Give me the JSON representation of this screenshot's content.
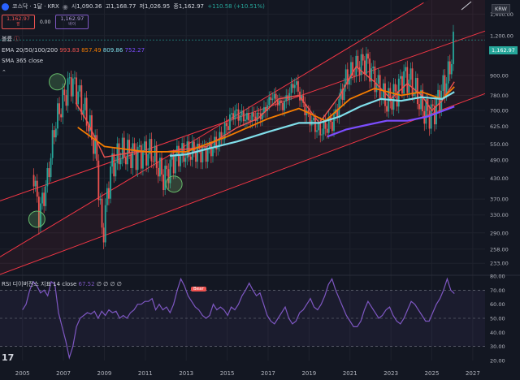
{
  "header": {
    "symbol": "코스닥 · 1달 · KRX",
    "ohlc": {
      "o": "시1,090.36",
      "h": "고1,168.77",
      "l": "저1,026.95",
      "c": "종1,162.97",
      "chg": "+110.58 (+10.51%)"
    },
    "sell_price": "1,162.97",
    "sell_label": "팔",
    "spread": "0.00",
    "buy_price": "1,162.97",
    "buy_label": "바이",
    "volume_label": "볼륨",
    "ema_label": "EMA 20/50/100/200",
    "ema_vals": [
      "993.83",
      "857.49",
      "809.86",
      "752.27"
    ],
    "sma_label": "SMA 365 close",
    "rsi_label": "RSI 디이버전스 지표 14 close",
    "rsi_val": "67.52",
    "rsi_nulls": "∅ ∅ ∅ ∅",
    "currency": "KRW",
    "last_price": "1,162.97",
    "bear_label": "Bear",
    "logo": "17"
  },
  "colors": {
    "bg": "#131722",
    "up": "#26a69a",
    "down": "#ef5350",
    "ema20": "#ef5350",
    "ema50": "#f57c00",
    "ema100": "#80deea",
    "ema200": "#7c4dff",
    "channel": "#f23645",
    "rsi": "#7e57c2",
    "circle": "#66bb6a"
  },
  "chart_data": [
    {
      "type": "candlestick",
      "x_ticks": [
        "2005",
        "2007",
        "2009",
        "2011",
        "2013",
        "2015",
        "2017",
        "2019",
        "2021",
        "2023",
        "2025",
        "2027"
      ],
      "y_scale": "log",
      "y_ticks": [
        233,
        258,
        290,
        330,
        370,
        430,
        490,
        550,
        625,
        700,
        780,
        900,
        1200,
        1400
      ],
      "ylim": [
        215,
        1550
      ],
      "xlim": [
        2003.9,
        2027.6
      ],
      "last_close": 1162.97,
      "series": [
        {
          "name": "EMA 20",
          "points": [
            [
              2007.6,
              740
            ],
            [
              2008.2,
              640
            ],
            [
              2009.0,
              500
            ],
            [
              2010.5,
              520
            ],
            [
              2012.0,
              520
            ],
            [
              2014.0,
              540
            ],
            [
              2015.5,
              620
            ],
            [
              2016.5,
              660
            ],
            [
              2017.5,
              760
            ],
            [
              2018.5,
              780
            ],
            [
              2019.5,
              640
            ],
            [
              2020.5,
              780
            ],
            [
              2021.3,
              960
            ],
            [
              2022.2,
              860
            ],
            [
              2023.0,
              760
            ],
            [
              2023.8,
              850
            ],
            [
              2024.5,
              780
            ],
            [
              2025.0,
              700
            ],
            [
              2025.5,
              750
            ],
            [
              2026.1,
              860
            ]
          ]
        },
        {
          "name": "EMA 50",
          "points": [
            [
              2007.7,
              620
            ],
            [
              2009.0,
              540
            ],
            [
              2011.0,
              520
            ],
            [
              2013.0,
              520
            ],
            [
              2015.0,
              580
            ],
            [
              2017.0,
              660
            ],
            [
              2018.5,
              710
            ],
            [
              2019.8,
              650
            ],
            [
              2021.0,
              760
            ],
            [
              2022.2,
              820
            ],
            [
              2023.5,
              780
            ],
            [
              2024.5,
              800
            ],
            [
              2025.5,
              760
            ],
            [
              2026.1,
              830
            ]
          ]
        },
        {
          "name": "EMA 100",
          "points": [
            [
              2012.2,
              505
            ],
            [
              2013.0,
              510
            ],
            [
              2014.0,
              530
            ],
            [
              2015.5,
              560
            ],
            [
              2017.0,
              600
            ],
            [
              2018.5,
              640
            ],
            [
              2019.5,
              640
            ],
            [
              2020.5,
              670
            ],
            [
              2021.5,
              720
            ],
            [
              2022.5,
              760
            ],
            [
              2023.5,
              750
            ],
            [
              2024.5,
              770
            ],
            [
              2025.5,
              760
            ],
            [
              2026.1,
              800
            ]
          ]
        },
        {
          "name": "EMA 200",
          "points": [
            [
              2019.9,
              580
            ],
            [
              2020.8,
              610
            ],
            [
              2021.8,
              630
            ],
            [
              2022.8,
              650
            ],
            [
              2023.8,
              650
            ],
            [
              2024.8,
              670
            ],
            [
              2026.1,
              720
            ]
          ]
        }
      ],
      "channel": [
        {
          "from": [
            2003.9,
            244
          ],
          "to": [
            2024.6,
            1520
          ]
        },
        {
          "from": [
            2003.9,
            365
          ],
          "to": [
            2027.6,
            1240
          ]
        },
        {
          "from": [
            2003.9,
            215
          ],
          "to": [
            2027.6,
            790
          ]
        }
      ],
      "annotations": [
        [
          2006.7,
          860
        ],
        [
          2012.4,
          412
        ],
        [
          2005.7,
          320
        ]
      ]
    },
    {
      "type": "line",
      "series": [
        {
          "name": "RSI",
          "values": [
            56,
            60,
            70,
            76,
            73,
            68,
            70,
            66,
            76,
            74,
            54,
            44,
            34,
            22,
            30,
            44,
            50,
            52,
            54,
            53,
            55,
            50,
            55,
            52,
            56,
            54,
            55,
            50,
            52,
            50,
            54,
            56,
            60,
            60,
            62,
            62,
            64,
            56,
            60,
            56,
            58,
            54,
            60,
            70,
            78,
            73,
            66,
            62,
            58,
            56,
            52,
            50,
            52,
            60,
            56,
            58,
            56,
            52,
            58,
            56,
            60,
            66,
            70,
            75,
            70,
            66,
            68,
            60,
            52,
            48,
            46,
            50,
            54,
            58,
            50,
            46,
            48,
            54,
            56,
            60,
            64,
            58,
            56,
            60,
            66,
            74,
            78,
            70,
            64,
            58,
            52,
            48,
            44,
            44,
            48,
            56,
            62,
            58,
            54,
            50,
            52,
            56,
            58,
            52,
            48,
            46,
            50,
            56,
            62,
            60,
            56,
            52,
            48,
            48,
            54,
            60,
            64,
            70,
            78,
            70,
            67.52
          ]
        }
      ],
      "x_start": 2005.0,
      "x_end": 2026.1,
      "ylim": [
        20,
        80
      ],
      "y_ticks": [
        20,
        30,
        40,
        50,
        60,
        70,
        80
      ],
      "levels": [
        70,
        50,
        30
      ]
    }
  ]
}
